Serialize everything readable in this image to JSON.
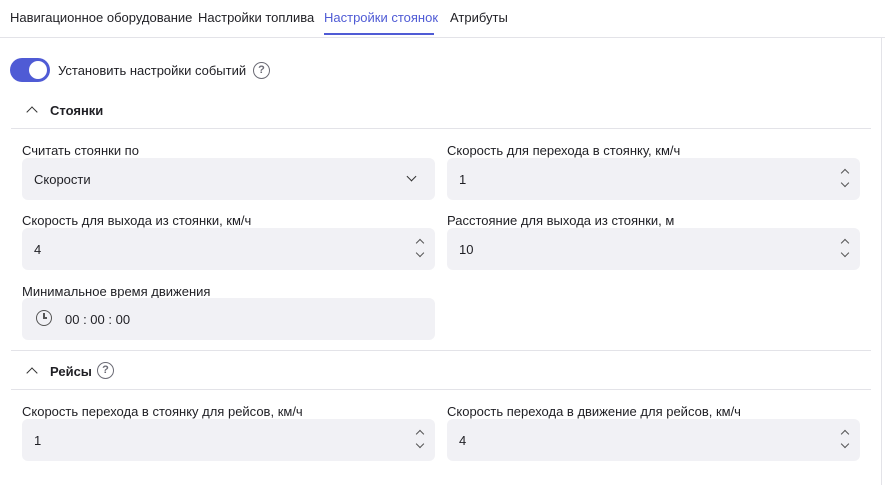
{
  "tabs": [
    {
      "label": "Навигационное оборудование"
    },
    {
      "label": "Настройки топлива"
    },
    {
      "label": "Настройки стоянок"
    },
    {
      "label": "Атрибуты"
    }
  ],
  "active_tab": "Настройки стоянок",
  "colors": {
    "accent": "#4f5bd5",
    "field_bg": "#f1f1f5"
  },
  "events_toggle": {
    "label": "Установить настройки событий",
    "on": true
  },
  "help_glyph": "?",
  "stops": {
    "title": "Стоянки",
    "count_by": {
      "label": "Считать стоянки по",
      "value": "Скорости"
    },
    "speed_to_stop": {
      "label": "Скорость для перехода в стоянку, км/ч",
      "value": "1"
    },
    "speed_exit_stop": {
      "label": "Скорость для выхода из стоянки, км/ч",
      "value": "4"
    },
    "distance_exit_stop": {
      "label": "Расстояние для выхода из стоянки, м",
      "value": "10"
    },
    "min_move_time": {
      "label": "Минимальное время движения",
      "value": "00 : 00 : 00"
    }
  },
  "trips": {
    "title": "Рейсы",
    "speed_to_stop": {
      "label": "Скорость перехода в стоянку для рейсов, км/ч",
      "value": "1"
    },
    "speed_to_move": {
      "label": "Скорость перехода в движение для рейсов, км/ч",
      "value": "4"
    }
  }
}
